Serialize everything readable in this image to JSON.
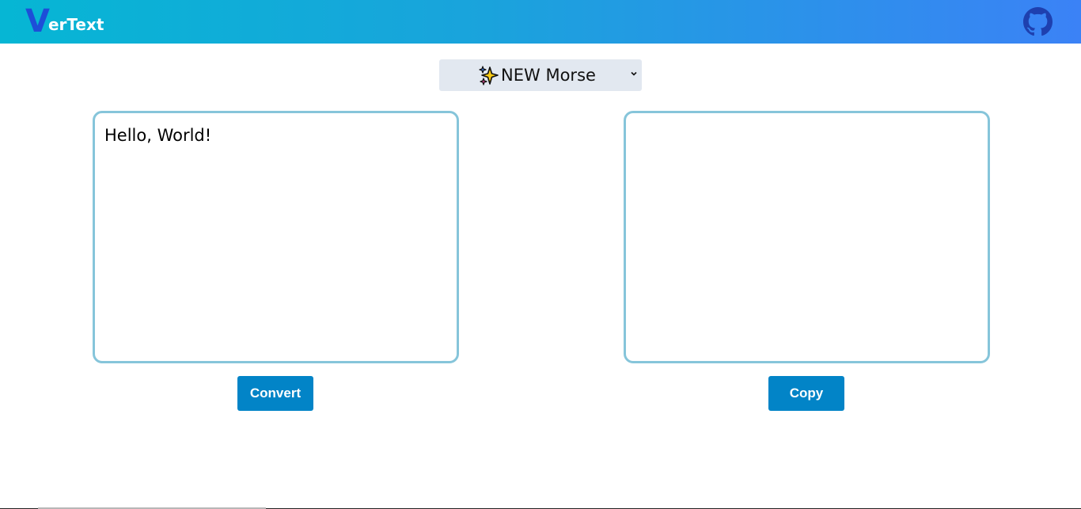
{
  "header": {
    "logo_letter": "V",
    "logo_rest": "erText",
    "github_icon": "github-icon",
    "colors": {
      "gradient_start": "#06b6d4",
      "gradient_end": "#3b82f6",
      "logo_v": "#1d4ed8"
    }
  },
  "mode_select": {
    "selected_label": "NEW Morse",
    "icon": "sparkles-icon"
  },
  "input": {
    "value": "Hello, World!"
  },
  "output": {
    "value": ""
  },
  "actions": {
    "convert_label": "Convert",
    "copy_label": "Copy",
    "button_color": "#0284c7"
  }
}
